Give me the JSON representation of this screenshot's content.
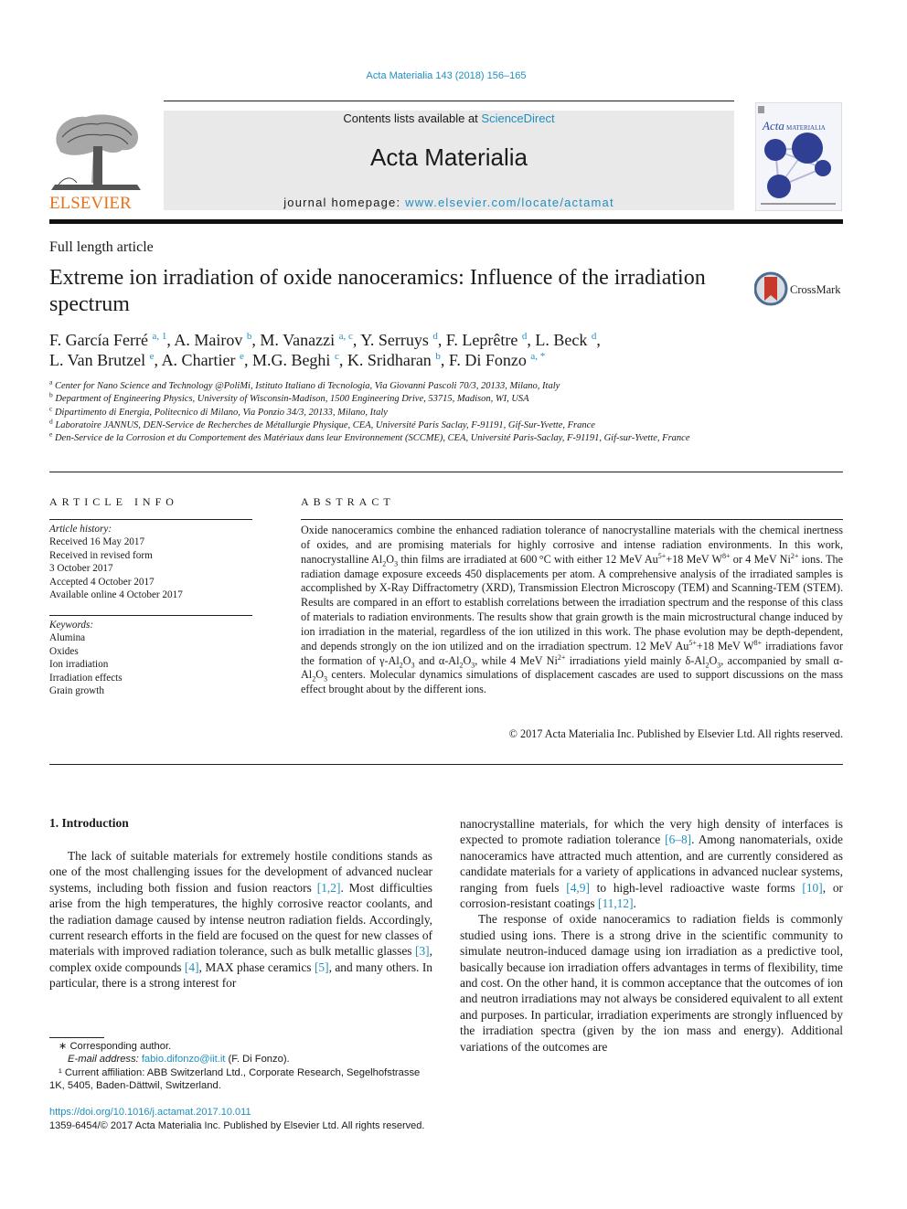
{
  "header": {
    "journal_ref": "Acta Materialia 143 (2018) 156–165",
    "publisher_logo_text": "ELSEVIER",
    "contents_prefix": "Contents lists available at ",
    "contents_link": "ScienceDirect",
    "journal_name": "Acta Materialia",
    "homepage_prefix": "journal homepage: ",
    "homepage_link": "www.elsevier.com/locate/actamat",
    "cover_title_italic": "Acta",
    "cover_title_rest": "MATERIALIA"
  },
  "article": {
    "type": "Full length article",
    "title": "Extreme ion irradiation of oxide nanoceramics: Influence of the irradiation spectrum",
    "crossmark_label": "CrossMark",
    "authors": [
      {
        "name": "F. García Ferré",
        "aff": "a, 1"
      },
      {
        "name": "A. Mairov",
        "aff": "b"
      },
      {
        "name": "M. Vanazzi",
        "aff": "a, c"
      },
      {
        "name": "Y. Serruys",
        "aff": "d"
      },
      {
        "name": "F. Leprêtre",
        "aff": "d"
      },
      {
        "name": "L. Beck",
        "aff": "d"
      },
      {
        "name": "L. Van Brutzel",
        "aff": "e"
      },
      {
        "name": "A. Chartier",
        "aff": "e"
      },
      {
        "name": "M.G. Beghi",
        "aff": "c"
      },
      {
        "name": "K. Sridharan",
        "aff": "b"
      },
      {
        "name": "F. Di Fonzo",
        "aff": "a, *"
      }
    ],
    "affiliations": [
      {
        "key": "a",
        "text": "Center for Nano Science and Technology @PoliMi, Istituto Italiano di Tecnologia, Via Giovanni Pascoli 70/3, 20133, Milano, Italy"
      },
      {
        "key": "b",
        "text": "Department of Engineering Physics, University of Wisconsin-Madison, 1500 Engineering Drive, 53715, Madison, WI, USA"
      },
      {
        "key": "c",
        "text": "Dipartimento di Energia, Politecnico di Milano, Via Ponzio 34/3, 20133, Milano, Italy"
      },
      {
        "key": "d",
        "text": "Laboratoire JANNUS, DEN-Service de Recherches de Métallurgie Physique, CEA, Université Paris Saclay, F-91191, Gif-Sur-Yvette, France"
      },
      {
        "key": "e",
        "text": "Den-Service de la Corrosion et du Comportement des Matériaux dans leur Environnement (SCCME), CEA, Université Paris-Saclay, F-91191, Gif-sur-Yvette, France"
      }
    ]
  },
  "article_info": {
    "heading": "ARTICLE INFO",
    "history_label": "Article history:",
    "history": [
      "Received 16 May 2017",
      "Received in revised form",
      "3 October 2017",
      "Accepted 4 October 2017",
      "Available online 4 October 2017"
    ],
    "keywords_label": "Keywords:",
    "keywords": [
      "Alumina",
      "Oxides",
      "Ion irradiation",
      "Irradiation effects",
      "Grain growth"
    ]
  },
  "abstract": {
    "heading": "ABSTRACT",
    "segments": [
      "Oxide nanoceramics combine the enhanced radiation tolerance of nanocrystalline materials with the chemical inertness of oxides, and are promising materials for highly corrosive and intense radiation environments. In this work, nanocrystalline Al",
      "2",
      "O",
      "3",
      " thin films are irradiated at 600 °C with either 12 MeV Au",
      "5+",
      "+18 MeV W",
      "8+",
      " or 4 MeV Ni",
      "2+",
      " ions. The radiation damage exposure exceeds 450 displacements per atom. A comprehensive analysis of the irradiated samples is accomplished by X-Ray Diffractometry (XRD), Transmission Electron Microscopy (TEM) and Scanning-TEM (STEM). Results are compared in an effort to establish correlations between the irradiation spectrum and the response of this class of materials to radiation environments. The results show that grain growth is the main microstructural change induced by ion irradiation in the material, regardless of the ion utilized in this work. The phase evolution may be depth-dependent, and depends strongly on the ion utilized and on the irradiation spectrum. 12 MeV Au",
      "5+",
      "+18 MeV W",
      "8+",
      " irradiations favor the formation of γ-Al",
      "2",
      "O",
      "3",
      " and α-Al",
      "2",
      "O",
      "3",
      ", while 4 MeV Ni",
      "2+",
      " irradiations yield mainly δ-Al",
      "2",
      "O",
      "3",
      ", accompanied by small α-Al",
      "2",
      "O",
      "3",
      " centers. Molecular dynamics simulations of displacement cascades are used to support discussions on the mass effect brought about by the different ions."
    ],
    "copyright": "© 2017 Acta Materialia Inc. Published by Elsevier Ltd. All rights reserved."
  },
  "introduction": {
    "heading": "1.  Introduction",
    "col1": [
      {
        "t": "The lack of suitable materials for extremely hostile conditions stands as one of the most challenging issues for the development of advanced nuclear systems, including both fission and fusion reactors "
      },
      {
        "ref": "[1,2]"
      },
      {
        "t": ". Most difficulties arise from the high temperatures, the highly corrosive reactor coolants, and the radiation damage caused by intense neutron radiation fields. Accordingly, current research efforts in the field are focused on the quest for new classes of materials with improved radiation tolerance, such as bulk metallic glasses "
      },
      {
        "ref": "[3]"
      },
      {
        "t": ", complex oxide compounds "
      },
      {
        "ref": "[4]"
      },
      {
        "t": ", MAX phase ceramics "
      },
      {
        "ref": "[5]"
      },
      {
        "t": ", and many others. In particular, there is a strong interest for"
      }
    ],
    "col2_p1": [
      {
        "t": "nanocrystalline materials, for which the very high density of interfaces is expected to promote radiation tolerance "
      },
      {
        "ref": "[6–8]"
      },
      {
        "t": ". Among nanomaterials, oxide nanoceramics have attracted much attention, and are currently considered as candidate materials for a variety of applications in advanced nuclear systems, ranging from fuels "
      },
      {
        "ref": "[4,9]"
      },
      {
        "t": " to high-level radioactive waste forms "
      },
      {
        "ref": "[10]"
      },
      {
        "t": ", or corrosion-resistant coatings "
      },
      {
        "ref": "[11,12]"
      },
      {
        "t": "."
      }
    ],
    "col2_p2": [
      {
        "t": "The response of oxide nanoceramics to radiation fields is commonly studied using ions. There is a strong drive in the scientific community to simulate neutron-induced damage using ion irradiation as a predictive tool, basically because ion irradiation offers advantages in terms of flexibility, time and cost. On the other hand, it is common acceptance that the outcomes of ion and neutron irradiations may not always be considered equivalent to all extent and purposes. In particular, irradiation experiments are strongly influenced by the irradiation spectra (given by the ion mass and energy). Additional variations of the outcomes are"
      }
    ]
  },
  "footnotes": {
    "corresponding": "∗  Corresponding author.",
    "email_label": "E-mail address: ",
    "email": "fabio.difonzo@iit.it",
    "email_suffix": " (F. Di Fonzo).",
    "affil_note": "¹  Current affiliation: ABB Switzerland Ltd., Corporate Research, Segelhofstrasse 1K, 5405, Baden-Dättwil, Switzerland.",
    "doi": "https://doi.org/10.1016/j.actamat.2017.10.011",
    "issn": "1359-6454/© 2017 Acta Materialia Inc. Published by Elsevier Ltd. All rights reserved."
  },
  "colors": {
    "link": "#1f8fc0",
    "elsevier_orange": "#e9711c",
    "banner_gray": "#e9e9e9",
    "cover_blue": "#2e4b9a"
  }
}
